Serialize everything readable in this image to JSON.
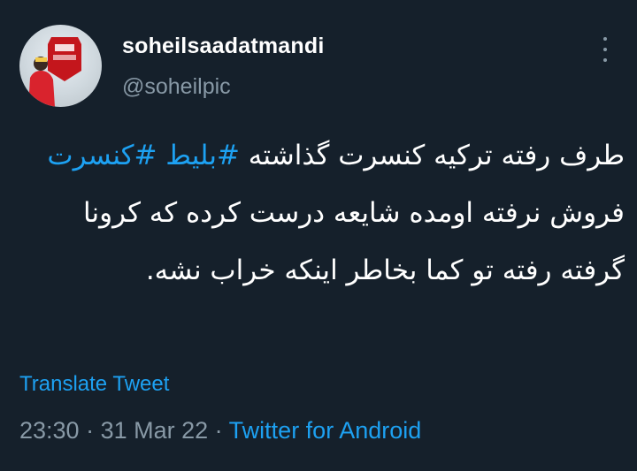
{
  "user": {
    "display_name": "soheilsaadatmandi",
    "handle": "@soheilpic",
    "avatar_icon": "profile-photo"
  },
  "more_icon": "three-dots-vertical-icon",
  "tweet": {
    "line1_text": "طرف رفته ترکیه کنسرت گذاشته ",
    "hashtag1": "#بلیط",
    "hashtag2": "#کنسرت",
    "line2_text": " فروش نرفته اومده شایعه درست کرده که کرونا گرفته رفته تو کما بخاطر اینکه خراب نشه."
  },
  "translate_label": "Translate Tweet",
  "meta": {
    "time": "23:30",
    "sep1": " · ",
    "date": "31 Mar 22",
    "sep2": " · ",
    "source": "Twitter for Android"
  },
  "colors": {
    "background": "#15202b",
    "accent": "#1da1f2",
    "secondary_text": "#8899a6"
  }
}
